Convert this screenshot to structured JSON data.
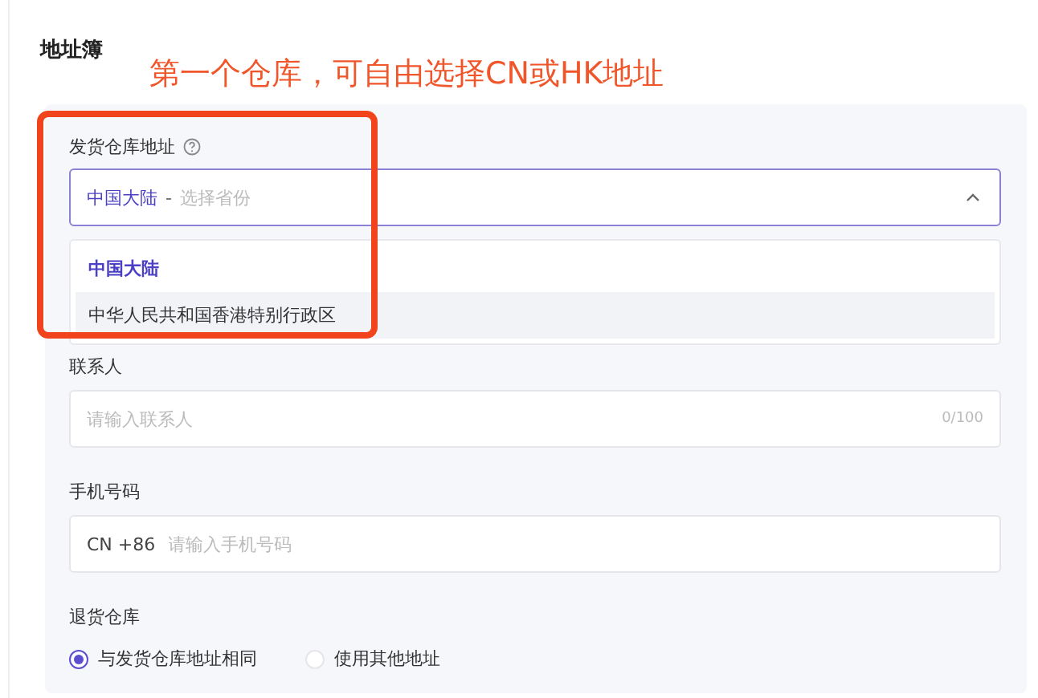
{
  "title": "地址簿",
  "annotation": {
    "text": "第一个仓库，可自由选择CN或HK地址"
  },
  "shipping_address": {
    "label": "发货仓库地址",
    "selected_value": "中国大陆",
    "separator": "-",
    "placeholder": "选择省份",
    "expanded": true,
    "options": [
      {
        "label": "中国大陆",
        "selected": true,
        "highlighted": false
      },
      {
        "label": "中华人民共和国香港特别行政区",
        "selected": false,
        "highlighted": true
      }
    ]
  },
  "contact": {
    "label": "联系人",
    "placeholder": "请输入联系人",
    "counter": "0/100"
  },
  "phone": {
    "label": "手机号码",
    "prefix": "CN +86",
    "placeholder": "请输入手机号码"
  },
  "return_warehouse": {
    "label": "退货仓库",
    "options": [
      {
        "label": "与发货仓库地址相同",
        "selected": true
      },
      {
        "label": "使用其他地址",
        "selected": false
      }
    ]
  }
}
